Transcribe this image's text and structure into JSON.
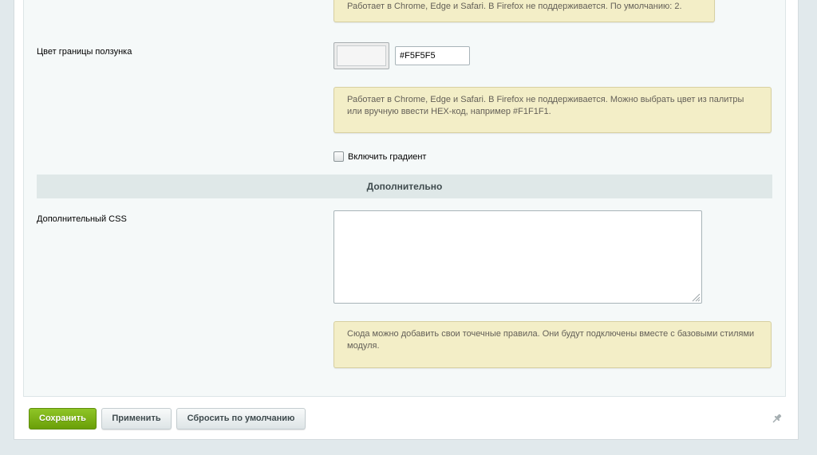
{
  "hints": {
    "top_partial": "Работает в Chrome, Edge и Safari. В Firefox не поддерживается. По умолчанию: 2.",
    "border_color": "Работает в Chrome, Edge и Safari. В Firefox не поддерживается. Можно выбрать цвет из палитры или вручную ввести HEX-код, например #F1F1F1.",
    "css": "Сюда можно добавить свои точечные правила. Они будут подключены вместе с базовыми стилями модуля."
  },
  "slider_border": {
    "label": "Цвет границы ползунка",
    "hex_value": "#F5F5F5",
    "swatch_color": "#F5F5F5"
  },
  "gradient": {
    "label": "Включить градиент",
    "checked": false
  },
  "section_extra": {
    "title": "Дополнительно"
  },
  "extra_css": {
    "label": "Дополнительный CSS",
    "value": ""
  },
  "footer": {
    "save_label": "Сохранить",
    "apply_label": "Применить",
    "reset_label": "Сбросить по умолчанию"
  },
  "icons": {
    "pin": "pin-icon",
    "resize": "resize-grip-icon"
  },
  "colors": {
    "save_button": "#7cb315",
    "hint_background": "#f3eec7"
  }
}
